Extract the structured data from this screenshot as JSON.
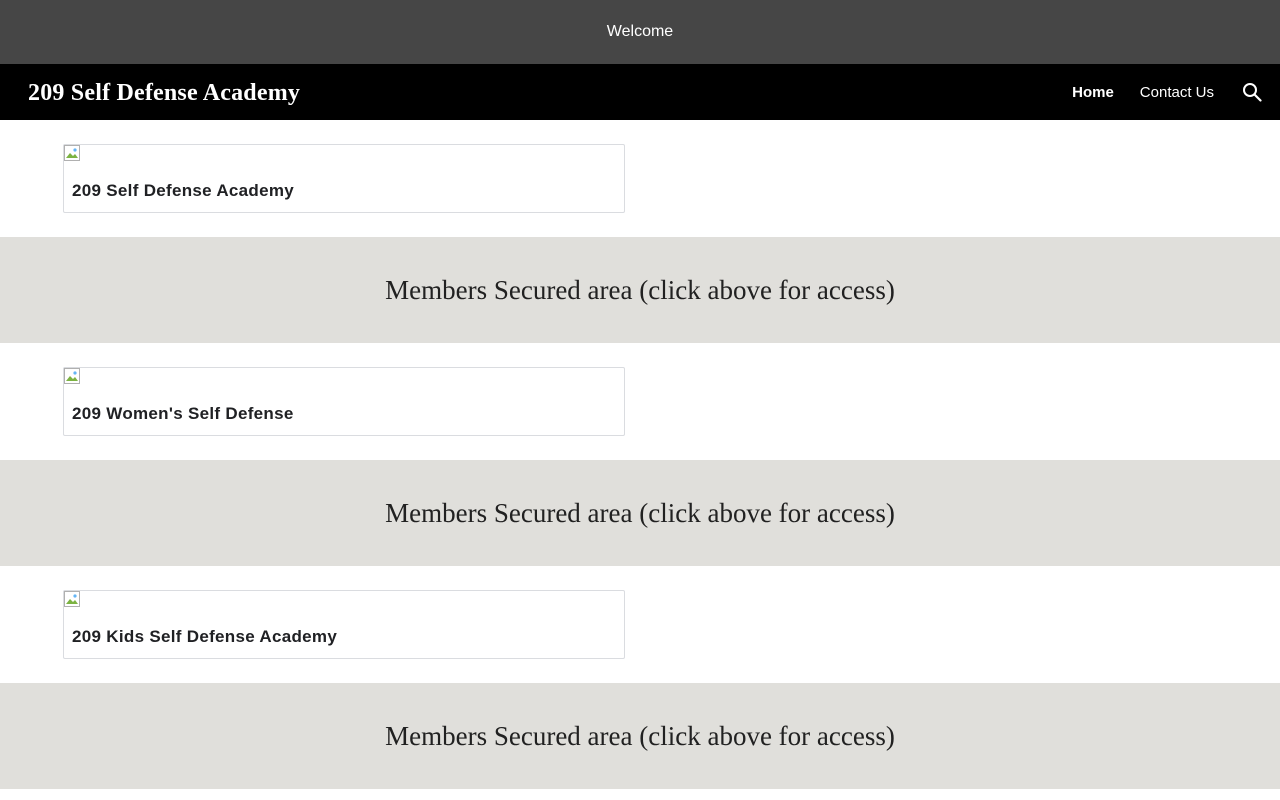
{
  "announcement": {
    "text": "Welcome"
  },
  "header": {
    "site_title": "209 Self Defense Academy",
    "nav": [
      {
        "label": "Home",
        "active": true
      },
      {
        "label": "Contact Us",
        "active": false
      }
    ],
    "search_icon": "search-icon"
  },
  "sections": [
    {
      "card_title": "209 Self Defense Academy",
      "band_text": "Members Secured area (click above for access)"
    },
    {
      "card_title": "209 Women's Self Defense",
      "band_text": "Members Secured area (click above for access)"
    },
    {
      "card_title": "209 Kids Self Defense Academy",
      "band_text": "Members Secured area (click above for access)"
    }
  ],
  "colors": {
    "announcement_bg": "#464646",
    "nav_bg": "#000000",
    "band_bg": "#e0dfdb"
  }
}
